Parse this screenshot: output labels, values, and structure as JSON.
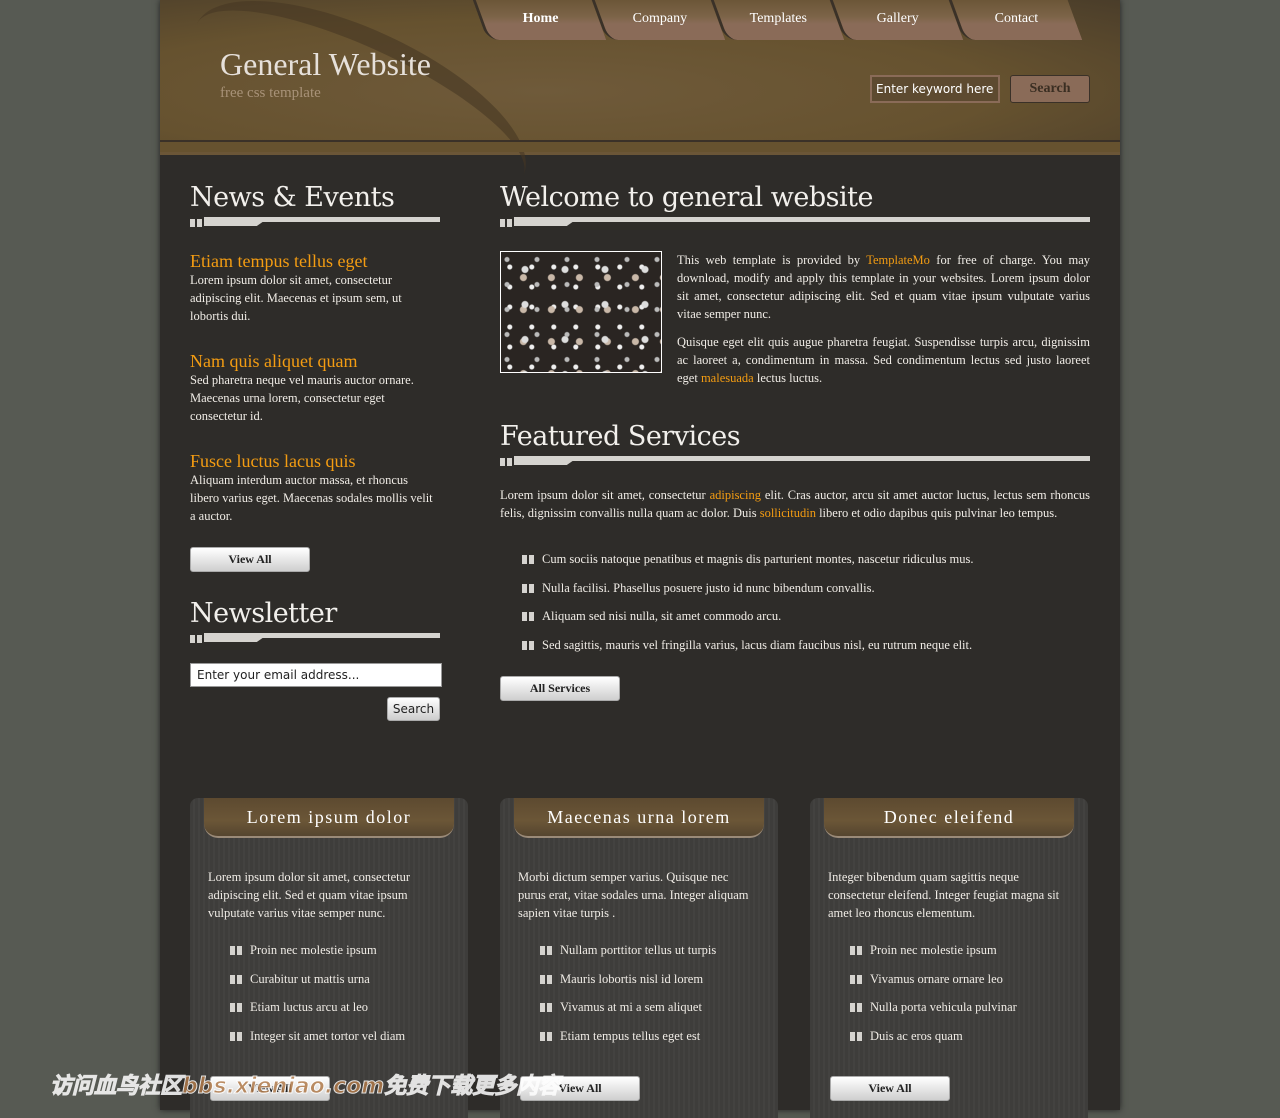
{
  "header": {
    "title": "General Website",
    "subtitle": "free css template",
    "search_placeholder": "Enter keyword here...",
    "search_button": "Search"
  },
  "menu": [
    "Home",
    "Company",
    "Templates",
    "Gallery",
    "Contact"
  ],
  "sidebar": {
    "news_title": "News & Events",
    "news": [
      {
        "title": "Etiam tempus tellus eget",
        "text": "Lorem ipsum dolor sit amet, consectetur adipiscing elit. Maecenas et ipsum sem, ut lobortis dui."
      },
      {
        "title": "Nam quis aliquet quam",
        "text": "Sed pharetra neque vel mauris auctor ornare. Maecenas urna lorem, consectetur eget consectetur id."
      },
      {
        "title": "Fusce luctus lacus quis",
        "text": "Aliquam interdum auctor massa, et rhoncus libero varius eget. Maecenas sodales mollis velit a auctor."
      }
    ],
    "view_all": "View All",
    "newsletter_title": "Newsletter",
    "email_placeholder": "Enter your email address...",
    "newsletter_button": "Search"
  },
  "main": {
    "welcome_title": "Welcome to general website",
    "p1_a": "This web template is provided by ",
    "p1_link": "TemplateMo",
    "p1_b": " for free of charge. You may download, modify and apply this template in your websites. Lorem ipsum dolor sit amet, consectetur adipiscing elit. Sed et quam vitae ipsum vulputate varius vitae semper nunc.",
    "p2_a": "Quisque eget elit quis augue pharetra feugiat. Suspendisse turpis arcu, dignissim ac laoreet a, condimentum in massa. Sed condimentum lectus sed justo laoreet eget ",
    "p2_link": "malesuada",
    "p2_b": " lectus luctus.",
    "services_title": "Featured Services",
    "s_a": "Lorem ipsum dolor sit amet, consectetur ",
    "s_link1": "adipiscing",
    "s_b": " elit. Cras auctor, arcu sit amet auctor luctus, lectus sem rhoncus felis, dignissim convallis nulla quam ac dolor. Duis ",
    "s_link2": "sollicitudin",
    "s_c": " libero et odio dapibus quis pulvinar leo tempus.",
    "services": [
      "Cum sociis natoque penatibus et magnis dis parturient montes, nascetur ridiculus mus.",
      "Nulla facilisi. Phasellus posuere justo id nunc bibendum convallis.",
      "Aliquam sed nisi nulla, sit amet commodo arcu.",
      "Sed sagittis, mauris vel fringilla varius, lacus diam faucibus nisl, eu rutrum neque elit."
    ],
    "all_services": "All Services"
  },
  "boxes": [
    {
      "title": "Lorem ipsum dolor",
      "text": "Lorem ipsum dolor sit amet, consectetur adipiscing elit. Sed et quam vitae ipsum vulputate varius vitae semper nunc.",
      "items": [
        "Proin nec molestie ipsum",
        "Curabitur ut mattis urna",
        "Etiam luctus arcu at leo",
        "Integer sit amet tortor vel diam"
      ],
      "button": "View All"
    },
    {
      "title": "Maecenas urna lorem",
      "text": "Morbi dictum semper varius. Quisque nec purus erat, vitae sodales urna. Integer aliquam sapien vitae turpis .",
      "items": [
        "Nullam porttitor tellus ut turpis",
        "Mauris lobortis nisl id lorem",
        "Vivamus at mi a sem aliquet",
        "Etiam tempus tellus eget est"
      ],
      "button": "View All"
    },
    {
      "title": "Donec eleifend",
      "text": "Integer bibendum quam sagittis neque consectetur eleifend. Integer feugiat magna sit amet leo rhoncus elementum.",
      "items": [
        "Proin nec molestie ipsum",
        "Vivamus ornare ornare leo",
        "Nulla porta vehicula pulvinar",
        "Duis ac eros quam"
      ],
      "button": "View All"
    }
  ],
  "watermark": "访问血鸟社区bbs.xieniao.com免费下载更多内容"
}
